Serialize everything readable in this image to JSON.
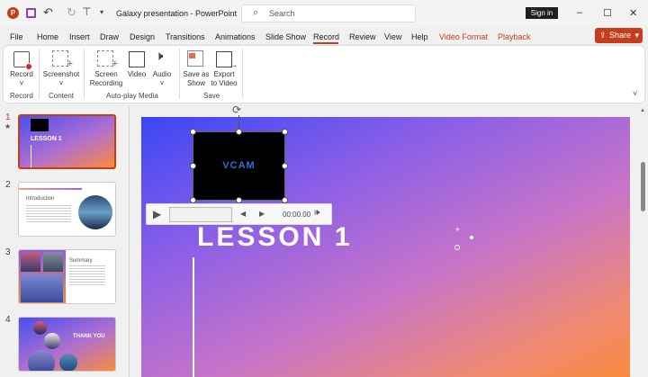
{
  "titlebar": {
    "doc_title": "Galaxy presentation - PowerPoint",
    "search_placeholder": "Search",
    "sign_in": "Sign in"
  },
  "menu": {
    "tabs": [
      "File",
      "Home",
      "Insert",
      "Draw",
      "Design",
      "Transitions",
      "Animations",
      "Slide Show",
      "Record",
      "Review",
      "View",
      "Help",
      "Video Format",
      "Playback"
    ],
    "active": "Record",
    "share": "Share"
  },
  "ribbon": {
    "buttons": {
      "record": "Record",
      "screenshot": "Screenshot",
      "screen_recording_1": "Screen",
      "screen_recording_2": "Recording",
      "video": "Video",
      "audio": "Audio",
      "save_show_1": "Save as",
      "save_show_2": "Show",
      "export_1": "Export",
      "export_2": "to Video"
    },
    "groups": {
      "record": "Record",
      "content": "Content",
      "autoplay": "Auto-play Media",
      "save": "Save"
    }
  },
  "slides": [
    {
      "num": "1",
      "title": "LESSON 1"
    },
    {
      "num": "2",
      "title": "Introduction"
    },
    {
      "num": "3",
      "title": "Summary"
    },
    {
      "num": "4",
      "title": "THANK YOU"
    }
  ],
  "main_slide": {
    "video_label": "VCAM",
    "time": "00:00.00",
    "title": "LESSON 1"
  },
  "colors": {
    "accent": "#c43e1c"
  }
}
